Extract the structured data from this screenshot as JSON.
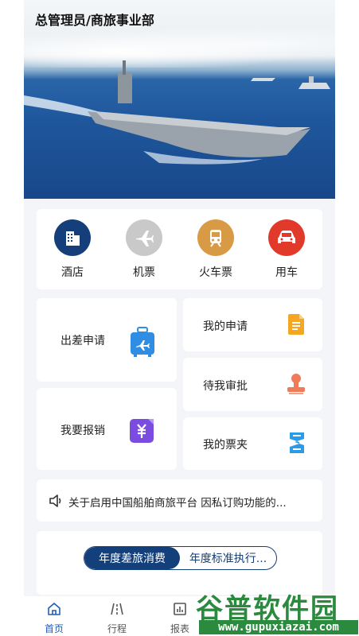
{
  "header": {
    "title": "总管理员/商旅事业部"
  },
  "services": [
    {
      "label": "酒店",
      "icon": "hotel-icon",
      "color": "#143f7a"
    },
    {
      "label": "机票",
      "icon": "airplane-icon",
      "color": "#c9c9c9"
    },
    {
      "label": "火车票",
      "icon": "train-icon",
      "color": "#d99a45"
    },
    {
      "label": "用车",
      "icon": "car-icon",
      "color": "#e23a2a"
    }
  ],
  "grid": {
    "trip_apply": "出差申请",
    "reimburse": "我要报销",
    "my_apply": "我的申请",
    "pending_approval": "待我审批",
    "my_tickets": "我的票夹"
  },
  "notice": {
    "text": "关于启用中国船舶商旅平台 因私订购功能的..."
  },
  "stats": {
    "tabs": [
      "年度差旅消费",
      "年度标准执行..."
    ],
    "active": 0
  },
  "tabbar": [
    "首页",
    "行程",
    "报表"
  ],
  "watermark": {
    "cn": "谷普软件园",
    "url": "www.gupuxiazai.com"
  },
  "colors": {
    "accent": "#133f7a",
    "background": "#f3f5f9",
    "watermark": "#2b8a3e"
  }
}
